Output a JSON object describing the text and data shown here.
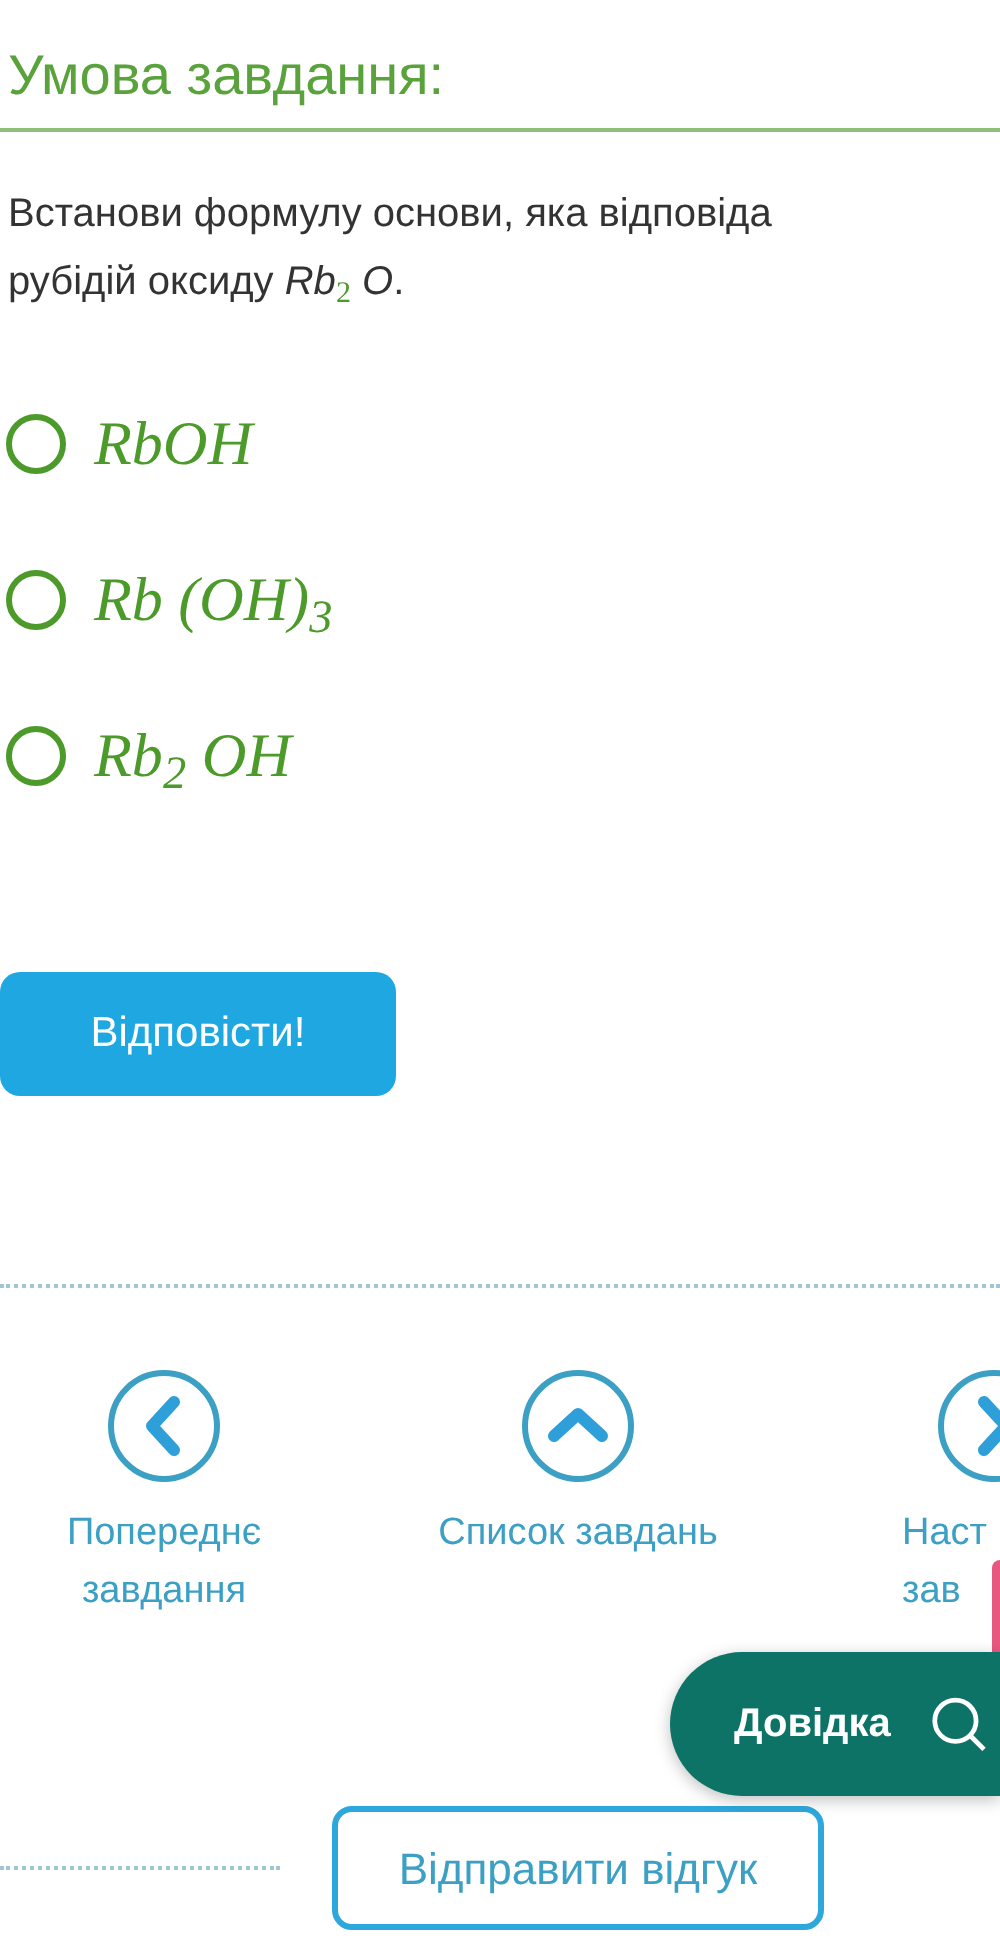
{
  "heading": "Умова завдання:",
  "question": [
    "Встанови формулу основи, яка відповіда",
    "рубідій оксиду *Rb*$_{2}$ *O*."
  ],
  "options": [
    {
      "formula": "RbOH",
      "selected": false
    },
    {
      "formula": "Rb (OH)$_{3}$",
      "selected": false
    },
    {
      "formula": "Rb$_{2}$ OH",
      "selected": false
    }
  ],
  "answer_button": "Відповісти!",
  "navigation": [
    {
      "kind": "previous",
      "label": "Попереднє\nзавдання"
    },
    {
      "kind": "list",
      "label": "Список завдань"
    },
    {
      "kind": "next",
      "label": "Наст\nзав"
    }
  ],
  "help_button": "Довідка",
  "feedback_button": "Відправити відгук"
}
